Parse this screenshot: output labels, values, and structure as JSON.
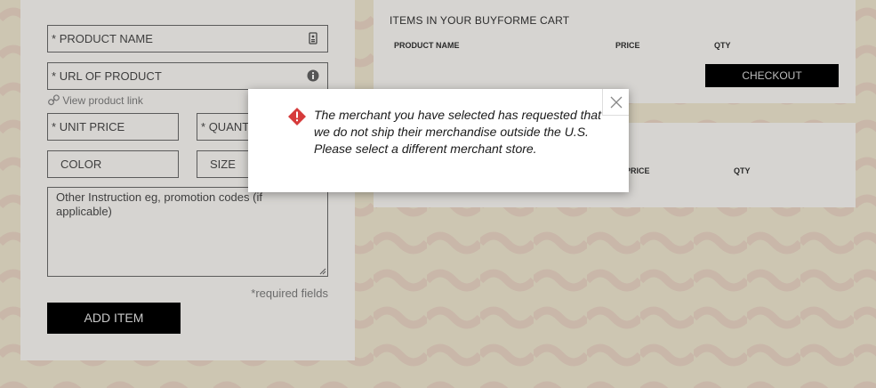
{
  "form": {
    "product_name_label": "PRODUCT NAME",
    "url_label": "URL OF PRODUCT",
    "view_link": "View product link",
    "unit_price_label": "UNIT PRICE",
    "quantity_label": "QUANT",
    "color_label": "COLOR",
    "size_label": "SIZE",
    "instruction_placeholder": "Other Instruction eg, promotion codes (if applicable)",
    "required_note": "*required fields",
    "add_item": "ADD ITEM",
    "required_marker": "*"
  },
  "cart": {
    "title": "ITEMS IN YOUR BUYFORME CART",
    "col_product": "PRODUCT NAME",
    "col_price": "PRICE",
    "col_qty": "QTY",
    "checkout": "CHECKOUT"
  },
  "second_table": {
    "col_price": "PRICE",
    "col_qty": "QTY"
  },
  "modal": {
    "message": "The merchant you have selected has requested that we do not ship their merchandise outside the U.S. Please select a different merchant store."
  },
  "colors": {
    "overlay_bg": "#cdc6b2",
    "panel_bg": "#d6d4d1",
    "button_black": "#000000",
    "warning_red": "#d63b3b"
  },
  "icons": {
    "product_name": "contact-card-icon",
    "url": "info-icon",
    "view_link": "link-icon",
    "modal_warning": "warning-diamond-icon",
    "modal_close": "close-icon"
  }
}
